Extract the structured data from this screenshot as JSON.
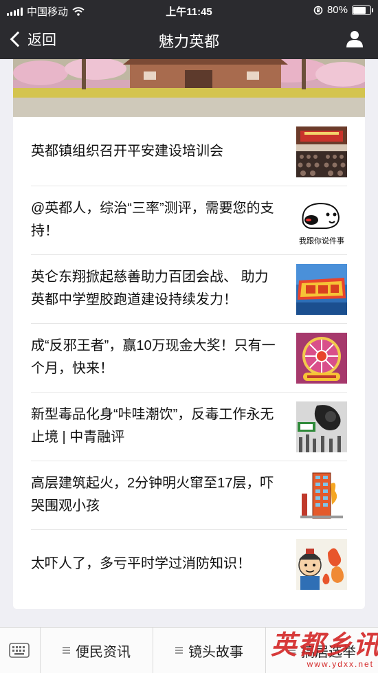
{
  "status": {
    "carrier": "中国移动",
    "time": "上午11:45",
    "battery": "80%",
    "battery_level": 0.8
  },
  "nav": {
    "back_label": "返回",
    "title": "魅力英都"
  },
  "articles": [
    {
      "title": "英都镇组织召开平安建设培训会"
    },
    {
      "title": "@英都人，综治“三率”测评，需要您的支持！",
      "thumb_caption": "我跟你说件事"
    },
    {
      "title": "英仑东翔掀起慈善助力百团会战、 助力英都中学塑胶跑道建设持续发力！"
    },
    {
      "title": "成“反邪王者”，赢10万现金大奖！只有一个月，快来！"
    },
    {
      "title": "新型毒品化身“咔哇潮饮”，反毒工作永无止境 | 中青融评"
    },
    {
      "title": "高层建筑起火，2分钟明火窜至17层，吓哭围观小孩"
    },
    {
      "title": "太吓人了，多亏平时学过消防知识！"
    }
  ],
  "tabbar": {
    "tabs": [
      "便民资讯",
      "镜头故事",
      "搞居选举"
    ]
  },
  "watermark": {
    "brand": "英都乡讯",
    "url": "www.ydxx.net"
  }
}
